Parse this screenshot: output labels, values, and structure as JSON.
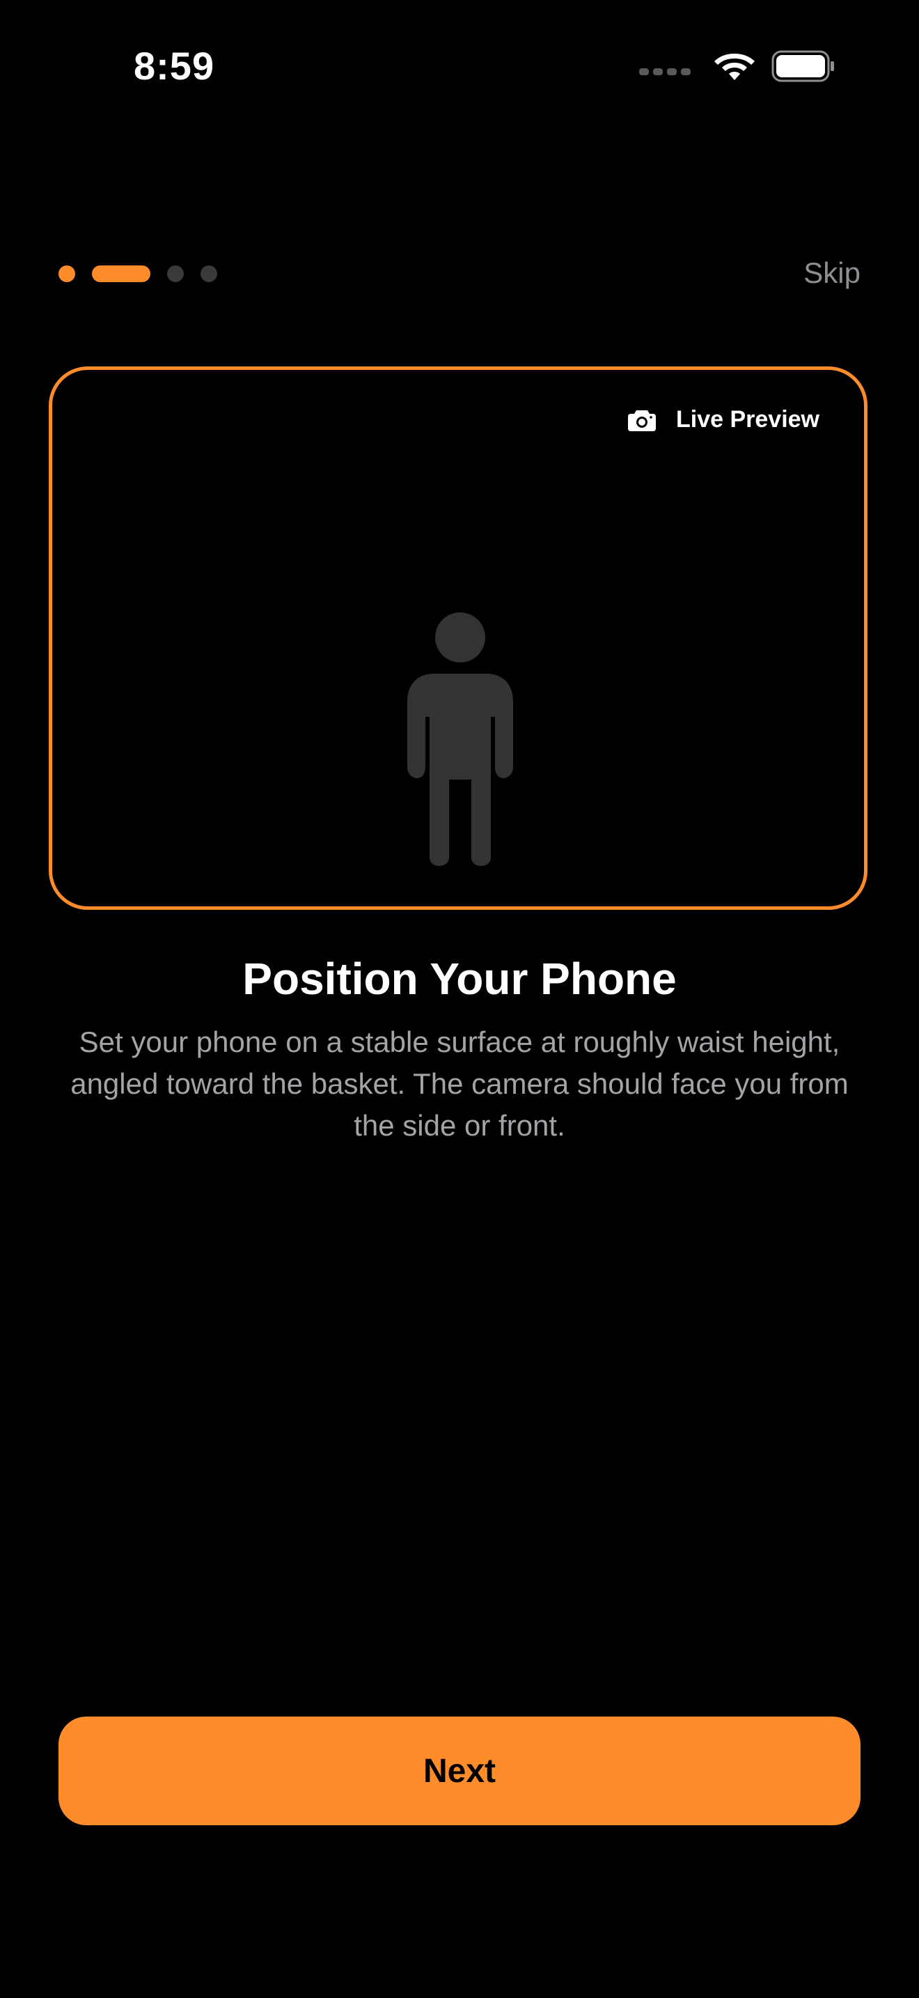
{
  "status_bar": {
    "time": "8:59"
  },
  "onboarding": {
    "skip_label": "Skip",
    "steps_total": 4,
    "current_step": 2
  },
  "preview": {
    "live_label": "Live Preview",
    "camera_icon": "camera-icon",
    "person_icon": "person-standing-icon"
  },
  "content": {
    "title": "Position Your Phone",
    "description": "Set your phone on a stable surface at roughly waist height, angled toward the basket. The camera should face you from the side or front."
  },
  "actions": {
    "next_label": "Next"
  },
  "colors": {
    "accent": "#ff8c2a",
    "background": "#000000",
    "secondary_text": "#a3a3a8",
    "muted": "#8e8e93",
    "silhouette": "#333333"
  }
}
